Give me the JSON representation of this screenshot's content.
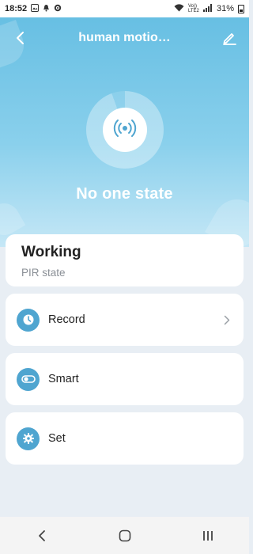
{
  "status_bar": {
    "time": "18:52",
    "network_label": "Vo)) LTE2",
    "battery_text": "31%"
  },
  "header": {
    "title": "human motio…",
    "back_icon": "back-arrow-icon",
    "edit_icon": "pencil-icon"
  },
  "hero": {
    "state": "No one state",
    "sensor_icon": "motion-sensor-icon"
  },
  "status_card": {
    "title": "Working",
    "subtitle": "PIR state"
  },
  "menu": [
    {
      "label": "Record",
      "icon": "clock-icon",
      "has_chevron": true
    },
    {
      "label": "Smart",
      "icon": "toggle-icon",
      "has_chevron": false
    },
    {
      "label": "Set",
      "icon": "gear-icon",
      "has_chevron": false
    }
  ],
  "colors": {
    "accent": "#4fa5d0",
    "hero_top": "#67bfe3",
    "background": "#e8eef4"
  }
}
